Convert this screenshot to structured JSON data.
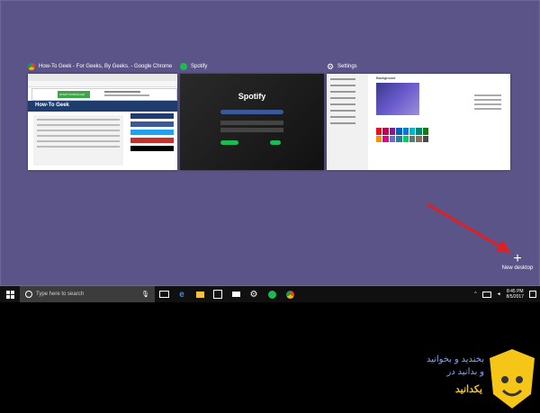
{
  "windows": [
    {
      "title": "How-To Geek - For Geeks, By Geeks. - Google Chrome",
      "logo_text": "How-To Geek",
      "ad_button": "START DOWNLOAD"
    },
    {
      "title": "Spotify",
      "logo_text": "Spotify"
    },
    {
      "title": "Settings",
      "heading": "Background"
    }
  ],
  "new_desktop": {
    "label": "New desktop"
  },
  "taskbar": {
    "search_placeholder": "Type here to search",
    "time": "8:45 PM",
    "date": "8/5/2017"
  },
  "watermark": {
    "line1": "بخندید و بخوانید",
    "line2": "و بدانید در",
    "line3": "یکدانید"
  },
  "colors": {
    "desktop": "#5a5488",
    "taskbar": "#101010",
    "arrow": "#e02020",
    "accent": "#3fa54a"
  }
}
